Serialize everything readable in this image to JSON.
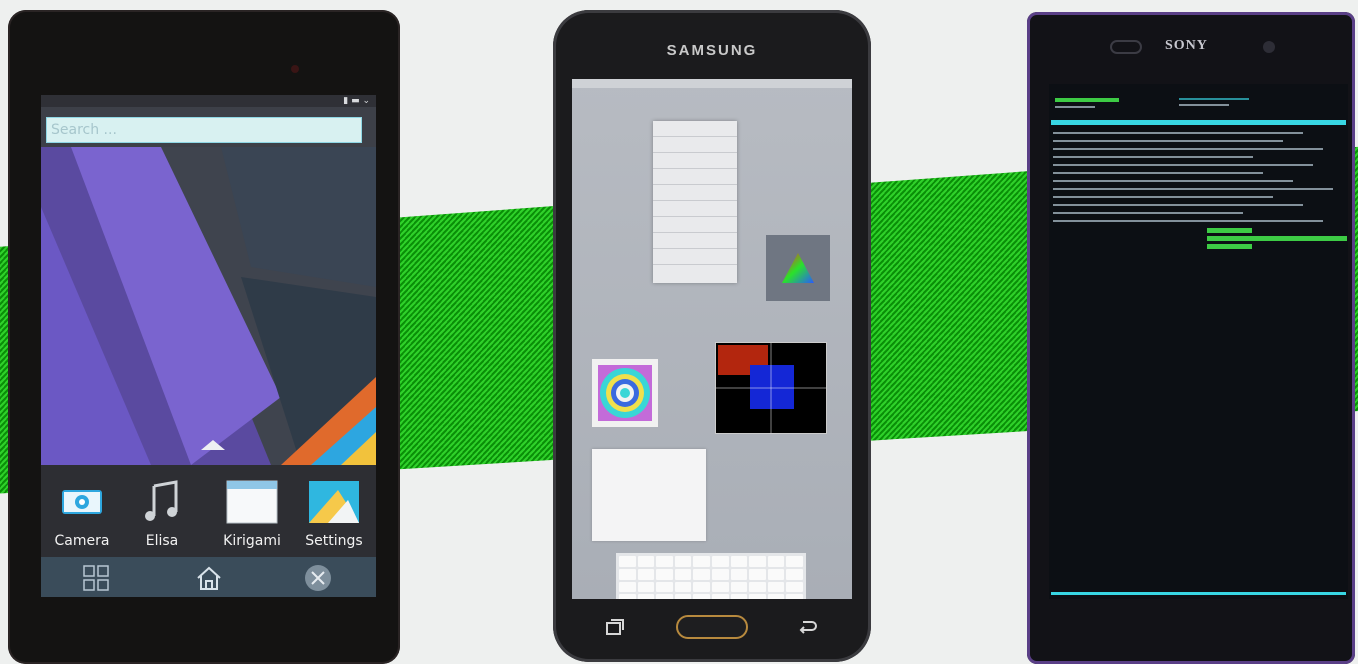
{
  "device1": {
    "search_placeholder": "Search ...",
    "apps": [
      {
        "label": "Camera",
        "icon": "camera-icon"
      },
      {
        "label": "Elisa",
        "icon": "music-note-icon"
      },
      {
        "label": "Kirigami",
        "icon": "window-icon"
      },
      {
        "label": "Settings",
        "icon": "settings-icon"
      }
    ],
    "nav": [
      "grid-icon",
      "home-icon",
      "close-icon"
    ]
  },
  "device2": {
    "brand": "SAMSUNG"
  },
  "device3": {
    "brand": "SONY"
  },
  "colors": {
    "stripe_green": "#2fd12a",
    "accent_cyan": "#38d6e4"
  }
}
